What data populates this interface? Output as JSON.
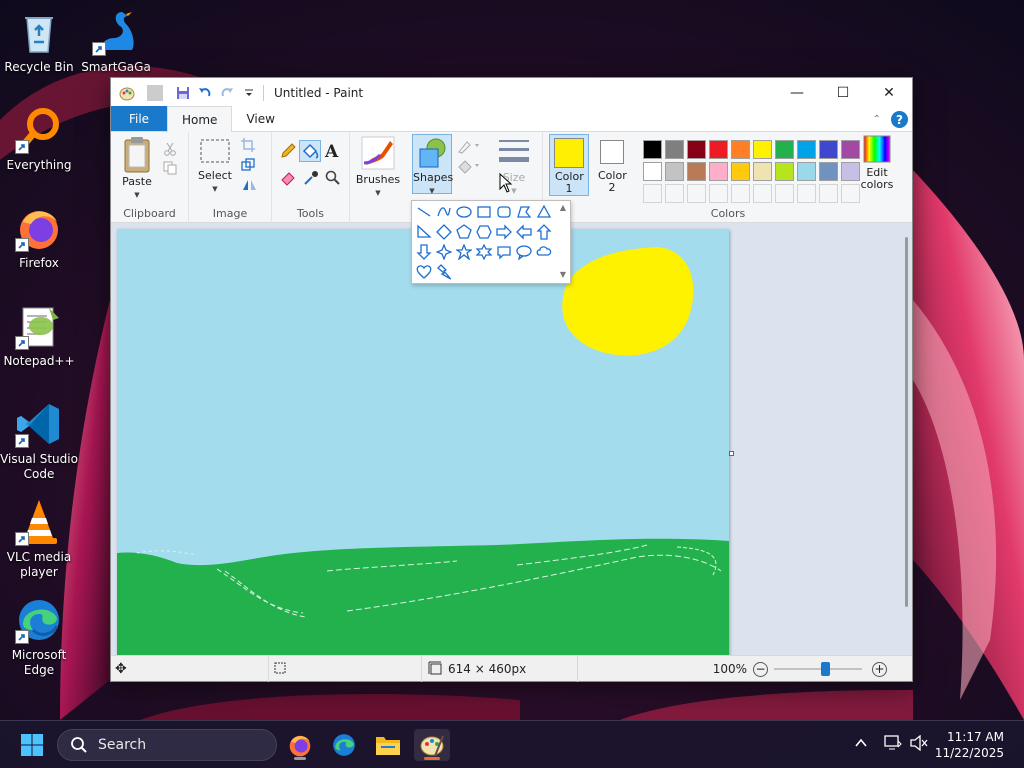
{
  "desktop": {
    "icons": [
      {
        "label": "Recycle Bin"
      },
      {
        "label": "SmartGaGa"
      },
      {
        "label": "Everything"
      },
      {
        "label": "Firefox"
      },
      {
        "label": "Notepad++"
      },
      {
        "label": "Visual Studio Code"
      },
      {
        "label": "VLC media player"
      },
      {
        "label": "Microsoft Edge"
      }
    ]
  },
  "window": {
    "title": "Untitled - Paint",
    "tabs": [
      {
        "label": "File"
      },
      {
        "label": "Home"
      },
      {
        "label": "View"
      }
    ],
    "help_label": "?"
  },
  "ribbon": {
    "clipboard": {
      "label": "Clipboard",
      "paste": "Paste"
    },
    "image": {
      "label": "Image",
      "select": "Select"
    },
    "tools": {
      "label": "Tools"
    },
    "brushes": "Brushes",
    "shapes": "Shapes",
    "size": "Size",
    "color1": "Color 1",
    "color2": "Color 2",
    "colors": {
      "label": "Colors",
      "edit": "Edit colors"
    },
    "text_tool": "A",
    "color1_value": "#ffef00",
    "color2_value": "#ffffff",
    "palette_row1": [
      "#000000",
      "#7f7f7f",
      "#880015",
      "#ed1c24",
      "#ff7f27",
      "#fff200",
      "#22b14c",
      "#00a2e8",
      "#3f48cc",
      "#a349a4"
    ],
    "palette_row2": [
      "#ffffff",
      "#c3c3c3",
      "#b97a57",
      "#ffaec9",
      "#ffc90e",
      "#efe4b0",
      "#b5e61d",
      "#99d9ea",
      "#7092be",
      "#c8bfe7"
    ]
  },
  "status": {
    "canvas_size": "614 × 460px",
    "zoom": "100%",
    "zoom_level": 0.6
  },
  "taskbar": {
    "search_placeholder": "Search",
    "time": "11:17 AM",
    "date": "11/22/2025"
  }
}
